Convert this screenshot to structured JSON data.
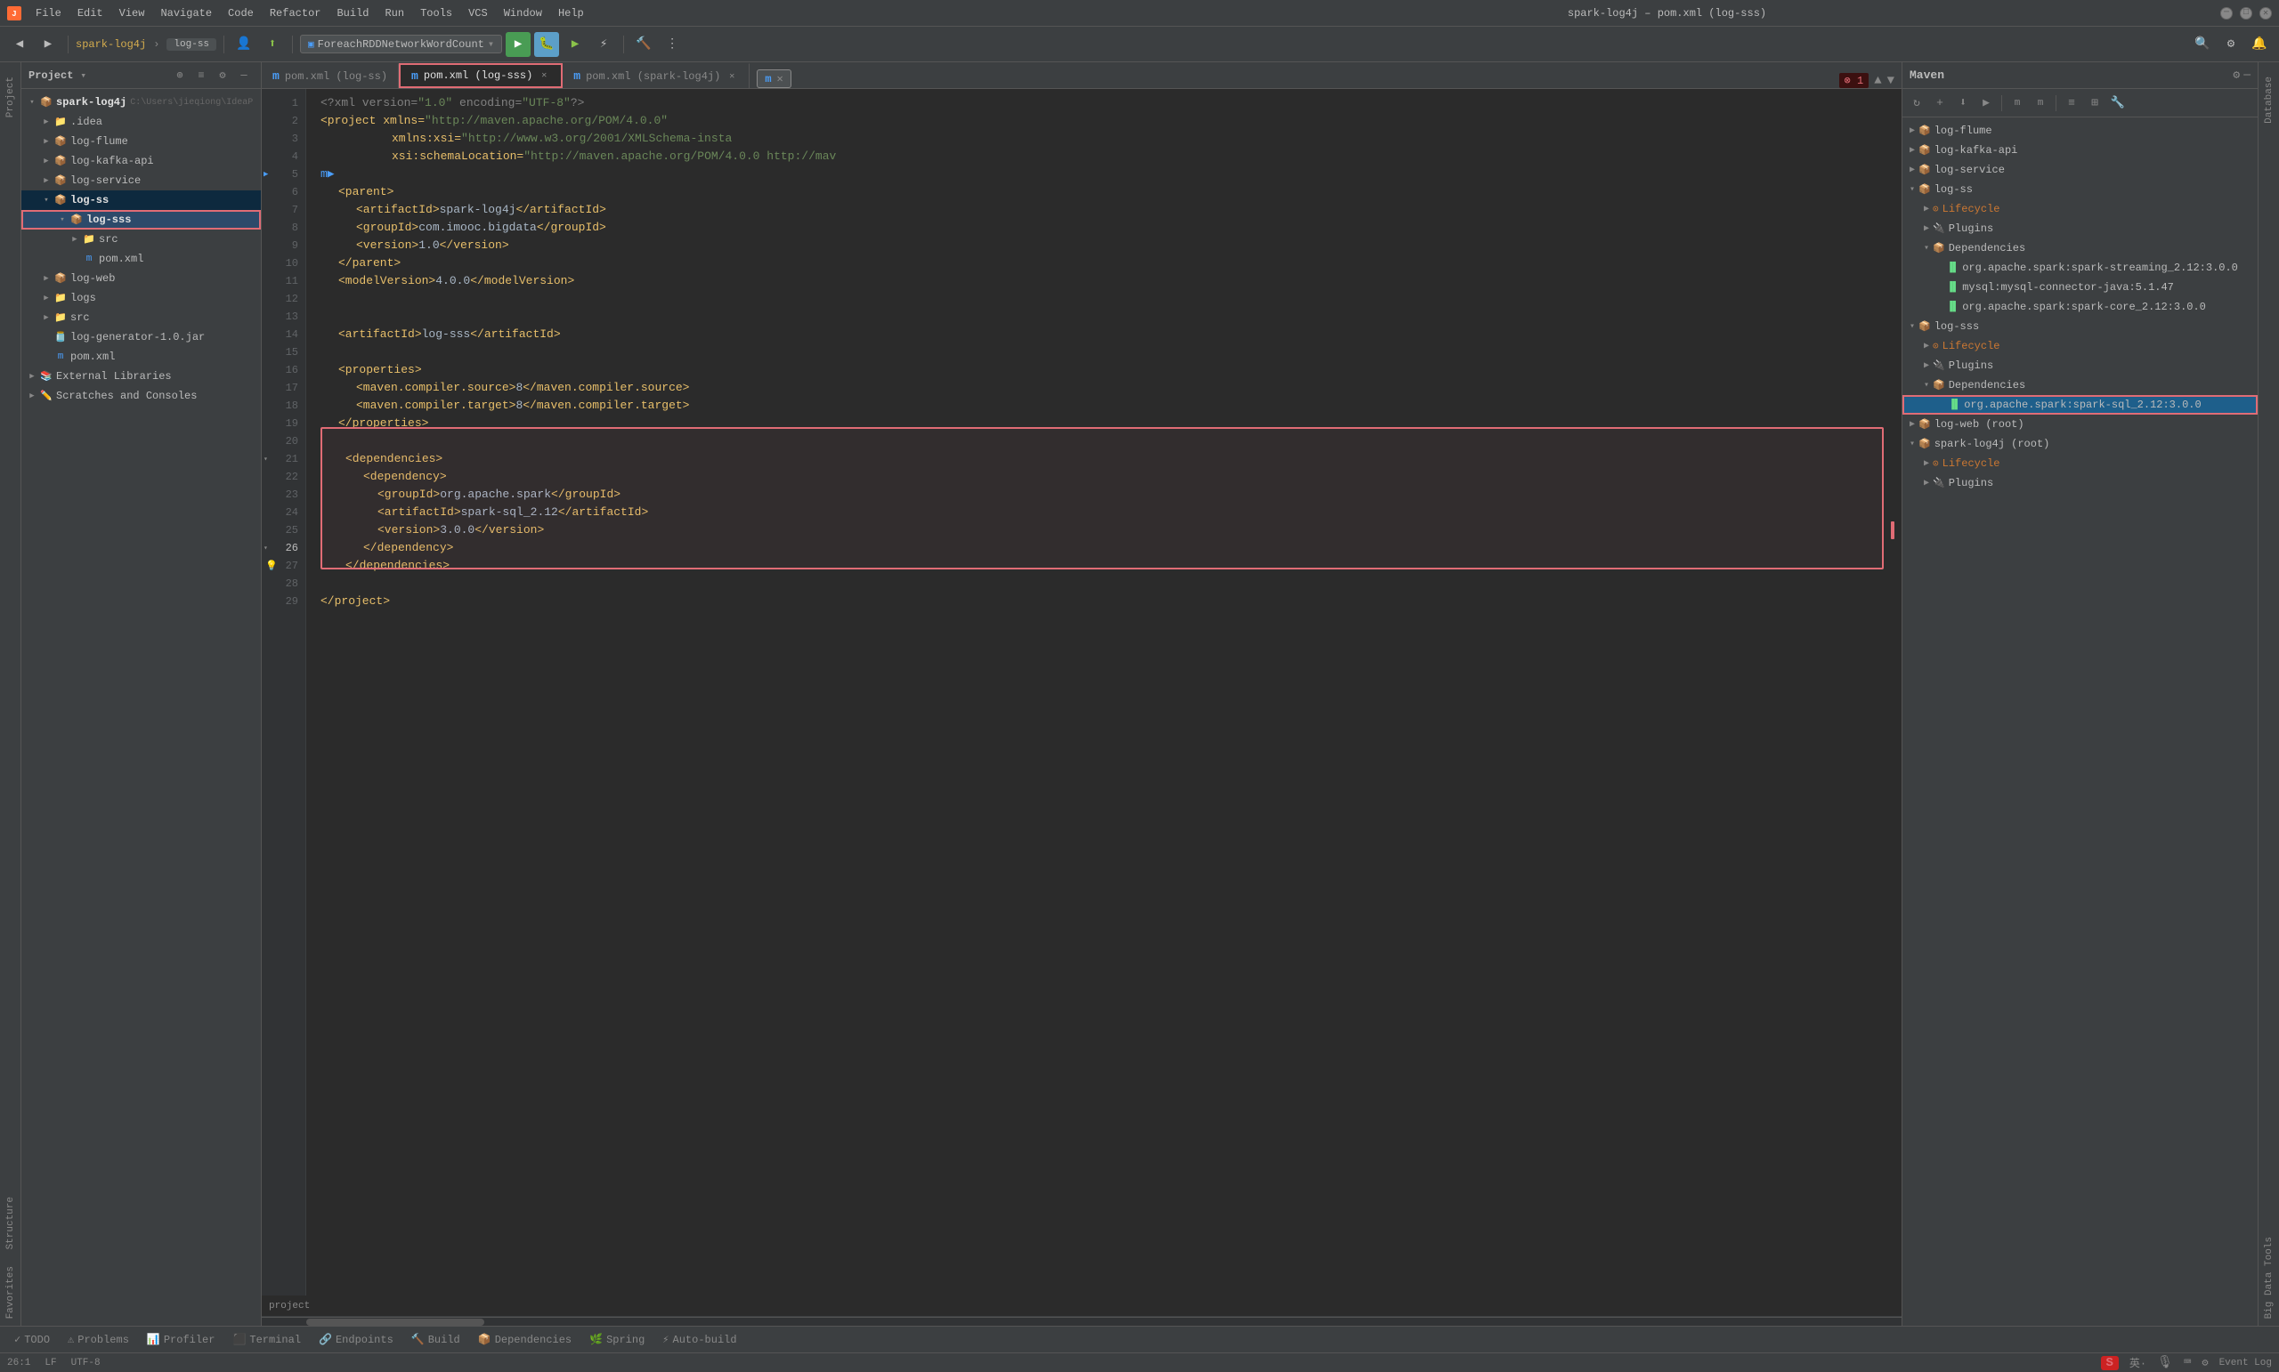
{
  "titleBar": {
    "appName": "spark-log4j",
    "fileName": "pom.xml (log-sss)",
    "fullTitle": "spark-log4j – pom.xml (log-sss)",
    "menuItems": [
      "File",
      "Edit",
      "View",
      "Navigate",
      "Code",
      "Refactor",
      "Build",
      "Run",
      "Tools",
      "VCS",
      "Window",
      "Help"
    ]
  },
  "toolbar": {
    "projectLabel": "spark-log4j",
    "branchLabel": "log-ss",
    "runConfig": "ForeachRDDNetworkWordCount"
  },
  "leftPanel": {
    "title": "Project",
    "tree": [
      {
        "id": "spark-log4j",
        "label": "spark-log4j",
        "indent": 0,
        "type": "root",
        "expanded": true,
        "path": "C:\\Users\\jieqiong\\IdeaP"
      },
      {
        "id": "idea",
        "label": ".idea",
        "indent": 1,
        "type": "folder",
        "expanded": false
      },
      {
        "id": "log-flume",
        "label": "log-flume",
        "indent": 1,
        "type": "module",
        "expanded": false
      },
      {
        "id": "log-kafka-api",
        "label": "log-kafka-api",
        "indent": 1,
        "type": "module",
        "expanded": false
      },
      {
        "id": "log-service",
        "label": "log-service",
        "indent": 1,
        "type": "module",
        "expanded": false
      },
      {
        "id": "log-ss",
        "label": "log-ss",
        "indent": 1,
        "type": "module-bold",
        "expanded": true,
        "selected": true
      },
      {
        "id": "log-sss",
        "label": "log-sss",
        "indent": 2,
        "type": "module-bold",
        "expanded": true,
        "highlighted": true
      },
      {
        "id": "src",
        "label": "src",
        "indent": 3,
        "type": "folder",
        "expanded": false
      },
      {
        "id": "pom-xml-sss",
        "label": "pom.xml",
        "indent": 3,
        "type": "xml"
      },
      {
        "id": "log-web",
        "label": "log-web",
        "indent": 1,
        "type": "module",
        "expanded": false
      },
      {
        "id": "logs",
        "label": "logs",
        "indent": 1,
        "type": "folder",
        "expanded": false
      },
      {
        "id": "src-root",
        "label": "src",
        "indent": 1,
        "type": "folder",
        "expanded": false
      },
      {
        "id": "log-generator",
        "label": "log-generator-1.0.jar",
        "indent": 1,
        "type": "jar"
      },
      {
        "id": "pom-xml-root",
        "label": "pom.xml",
        "indent": 1,
        "type": "xml"
      },
      {
        "id": "external-libs",
        "label": "External Libraries",
        "indent": 0,
        "type": "external",
        "expanded": false
      },
      {
        "id": "scratches",
        "label": "Scratches and Consoles",
        "indent": 0,
        "type": "scratches",
        "expanded": false
      }
    ]
  },
  "tabs": [
    {
      "label": "pom.xml (log-ss)",
      "active": false,
      "highlighted": false
    },
    {
      "label": "pom.xml (log-sss)",
      "active": true,
      "highlighted": true
    },
    {
      "label": "pom.xml (spark-log4j)",
      "active": false,
      "highlighted": false
    }
  ],
  "editor": {
    "lines": [
      {
        "num": 1,
        "content": "<?xml version=\"1.0\" encoding=\"UTF-8\"?>",
        "type": "decl"
      },
      {
        "num": 2,
        "content": "<project xmlns=\"http://maven.apache.org/POM/4.0.0\"",
        "type": "tag"
      },
      {
        "num": 3,
        "content": "         xmlns:xsi=\"http://www.w3.org/2001/XMLSchema-insta",
        "type": "tag"
      },
      {
        "num": 4,
        "content": "         xsi:schemaLocation=\"http://maven.apache.org/POM/4.0.0 http://mav",
        "type": "tag"
      },
      {
        "num": 5,
        "content": "",
        "type": "empty",
        "hasMarker": true
      },
      {
        "num": 6,
        "content": "    <parent>",
        "type": "tag"
      },
      {
        "num": 7,
        "content": "        <artifactId>spark-log4j</artifactId>",
        "type": "tag"
      },
      {
        "num": 8,
        "content": "        <groupId>com.imooc.bigdata</groupId>",
        "type": "tag"
      },
      {
        "num": 9,
        "content": "        <version>1.0</version>",
        "type": "tag"
      },
      {
        "num": 10,
        "content": "    </parent>",
        "type": "tag"
      },
      {
        "num": 11,
        "content": "    <modelVersion>4.0.0</modelVersion>",
        "type": "tag"
      },
      {
        "num": 12,
        "content": "",
        "type": "empty"
      },
      {
        "num": 13,
        "content": "",
        "type": "empty"
      },
      {
        "num": 14,
        "content": "    <artifactId>log-sss</artifactId>",
        "type": "tag"
      },
      {
        "num": 15,
        "content": "",
        "type": "empty"
      },
      {
        "num": 16,
        "content": "    <properties>",
        "type": "tag"
      },
      {
        "num": 17,
        "content": "        <maven.compiler.source>8</maven.compiler.source>",
        "type": "tag"
      },
      {
        "num": 18,
        "content": "        <maven.compiler.target>8</maven.compiler.target>",
        "type": "tag"
      },
      {
        "num": 19,
        "content": "    </properties>",
        "type": "tag"
      },
      {
        "num": 20,
        "content": "",
        "type": "empty"
      },
      {
        "num": 21,
        "content": "        <dependencies>",
        "type": "tag"
      },
      {
        "num": 22,
        "content": "            <dependency>",
        "type": "tag"
      },
      {
        "num": 23,
        "content": "                <groupId>org.apache.spark</groupId>",
        "type": "tag"
      },
      {
        "num": 24,
        "content": "                <artifactId>spark-sql_2.12</artifactId>",
        "type": "tag"
      },
      {
        "num": 25,
        "content": "                <version>3.0.0</version>",
        "type": "tag"
      },
      {
        "num": 26,
        "content": "            </dependency>",
        "type": "tag"
      },
      {
        "num": 27,
        "content": "        </dependencies>",
        "type": "tag",
        "hasBulb": true
      },
      {
        "num": 28,
        "content": "",
        "type": "empty"
      },
      {
        "num": 29,
        "content": "    </project>",
        "type": "tag"
      }
    ],
    "breadcrumb": "project"
  },
  "maven": {
    "title": "Maven",
    "tree": [
      {
        "label": "log-flume",
        "indent": 0,
        "type": "module",
        "expanded": false
      },
      {
        "label": "log-kafka-api",
        "indent": 0,
        "type": "module",
        "expanded": false
      },
      {
        "label": "log-service",
        "indent": 0,
        "type": "module",
        "expanded": false
      },
      {
        "label": "log-ss",
        "indent": 0,
        "type": "module",
        "expanded": true
      },
      {
        "label": "Lifecycle",
        "indent": 1,
        "type": "lifecycle",
        "expanded": false
      },
      {
        "label": "Plugins",
        "indent": 1,
        "type": "plugins",
        "expanded": false
      },
      {
        "label": "Dependencies",
        "indent": 1,
        "type": "deps",
        "expanded": true
      },
      {
        "label": "org.apache.spark:spark-streaming_2.12:3.0.0",
        "indent": 2,
        "type": "dep"
      },
      {
        "label": "mysql:mysql-connector-java:5.1.47",
        "indent": 2,
        "type": "dep"
      },
      {
        "label": "org.apache.spark:spark-core_2.12:3.0.0",
        "indent": 2,
        "type": "dep"
      },
      {
        "label": "log-sss",
        "indent": 0,
        "type": "module",
        "expanded": true
      },
      {
        "label": "Lifecycle",
        "indent": 1,
        "type": "lifecycle",
        "expanded": false
      },
      {
        "label": "Plugins",
        "indent": 1,
        "type": "plugins",
        "expanded": false
      },
      {
        "label": "Dependencies",
        "indent": 1,
        "type": "deps",
        "expanded": true
      },
      {
        "label": "org.apache.spark:spark-sql_2.12:3.0.0",
        "indent": 2,
        "type": "dep",
        "selected": true
      },
      {
        "label": "log-web (root)",
        "indent": 0,
        "type": "module",
        "expanded": false
      },
      {
        "label": "spark-log4j (root)",
        "indent": 0,
        "type": "module",
        "expanded": true
      },
      {
        "label": "Lifecycle",
        "indent": 1,
        "type": "lifecycle",
        "expanded": false
      },
      {
        "label": "Plugins",
        "indent": 1,
        "type": "plugins",
        "expanded": false
      }
    ]
  },
  "bottomTabs": [
    {
      "label": "TODO",
      "icon": "✓"
    },
    {
      "label": "Problems",
      "icon": "⚠"
    },
    {
      "label": "Profiler",
      "icon": "📊"
    },
    {
      "label": "Terminal",
      "icon": "⬛"
    },
    {
      "label": "Endpoints",
      "icon": "🔗"
    },
    {
      "label": "Build",
      "icon": "🔨"
    },
    {
      "label": "Dependencies",
      "icon": "📦"
    },
    {
      "label": "Spring",
      "icon": "🌿"
    },
    {
      "label": "Auto-build",
      "icon": "⚡"
    }
  ],
  "statusBar": {
    "position": "26:1",
    "encoding": "LF",
    "charset": "UTF-8",
    "eventLog": "Event Log"
  },
  "notification": {
    "text": "m",
    "closeBtn": "×"
  },
  "icons": {
    "folder": "📁",
    "module": "📦",
    "xml": "📄",
    "jar": "🫙",
    "external": "📚",
    "scratches": "✏️",
    "search": "🔍",
    "settings": "⚙",
    "run": "▶",
    "debug": "🐛",
    "refresh": "↻",
    "collapse": "◀"
  }
}
